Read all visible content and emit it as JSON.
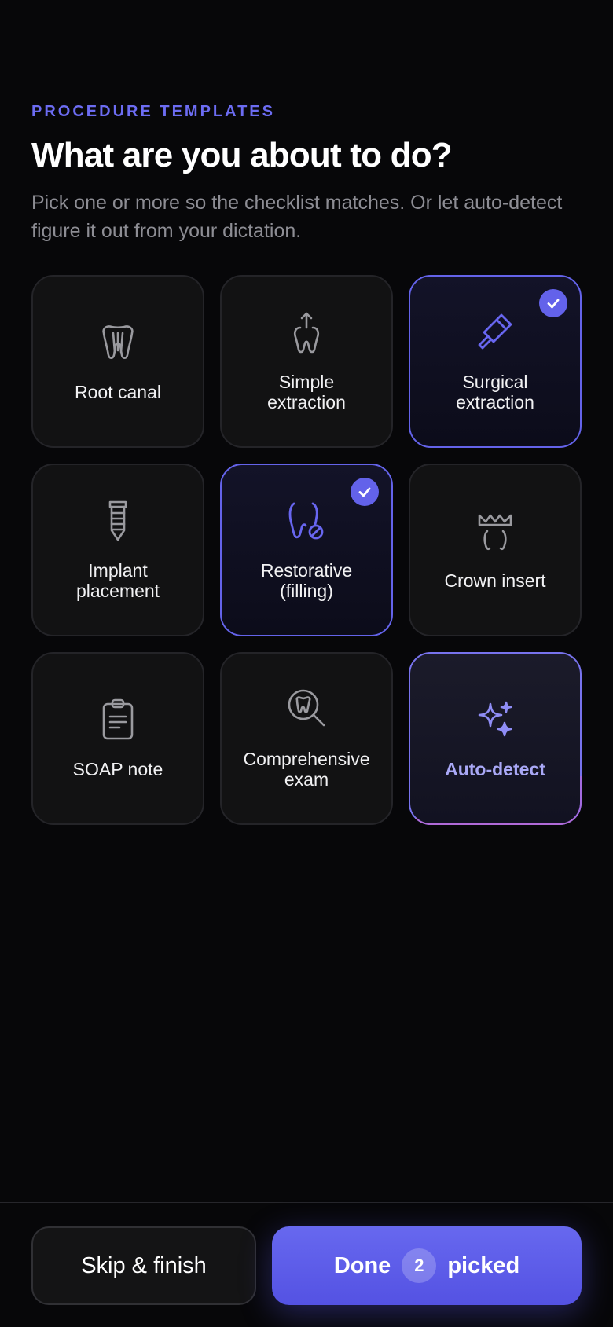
{
  "header": {
    "eyebrow": "PROCEDURE TEMPLATES",
    "title": "What are you about to do?",
    "subtitle": "Pick one or more so the checklist matches. Or let auto-detect figure it out from your dictation."
  },
  "colors": {
    "accent": "#6362ea",
    "icon_muted": "#9a9a9f",
    "auto_label": "#a9a8f6"
  },
  "templates": [
    {
      "label": "Root canal",
      "icon": "tooth-roots-icon",
      "selected": false
    },
    {
      "label": "Simple\nextraction",
      "icon": "tooth-extraction-icon",
      "selected": false
    },
    {
      "label": "Surgical\nextraction",
      "icon": "scalpel-icon",
      "selected": true
    },
    {
      "label": "Implant\nplacement",
      "icon": "implant-screw-icon",
      "selected": false
    },
    {
      "label": "Restorative\n(filling)",
      "icon": "tooth-filling-icon",
      "selected": true
    },
    {
      "label": "Crown insert",
      "icon": "crown-tooth-icon",
      "selected": false
    },
    {
      "label": "SOAP note",
      "icon": "clipboard-icon",
      "selected": false
    },
    {
      "label": "Comprehensive\nexam",
      "icon": "tooth-magnifier-icon",
      "selected": false
    },
    {
      "label": "Auto-detect",
      "icon": "sparkles-icon",
      "selected": false
    }
  ],
  "footer": {
    "skip_label": "Skip & finish",
    "done_label": "Done",
    "picked_count": "2",
    "picked_label": "picked"
  }
}
